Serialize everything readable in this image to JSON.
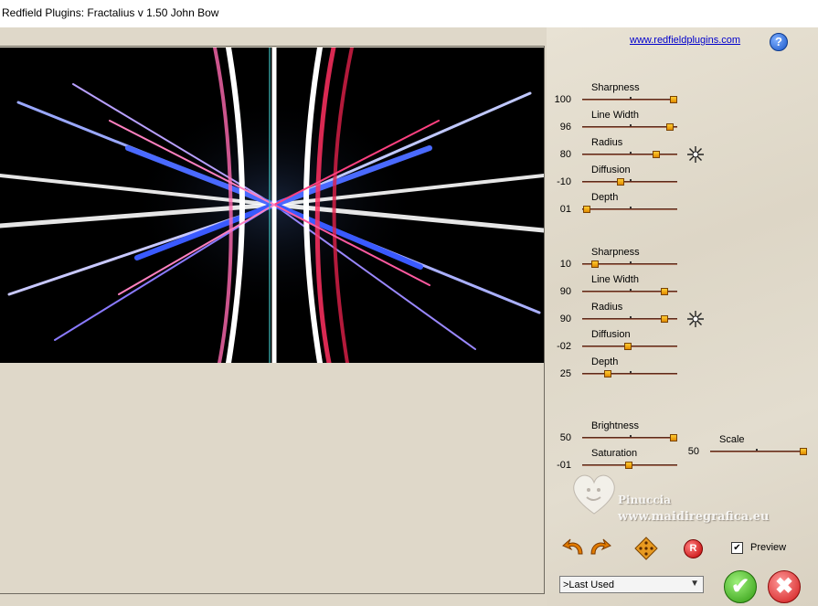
{
  "window": {
    "title": "Redfield Plugins: Fractalius v 1.50  John Bow"
  },
  "header": {
    "link": "www.redfieldplugins.com",
    "help_icon": "question-icon",
    "help_glyph": "?"
  },
  "group1": [
    {
      "label": "Sharpness",
      "value": "100",
      "level": 1.0
    },
    {
      "label": "Line Width",
      "value": "96",
      "level": 0.96
    },
    {
      "label": "Radius",
      "value": "80",
      "level": 0.8
    },
    {
      "label": "Diffusion",
      "value": "-10",
      "level": 0.4
    },
    {
      "label": "Depth",
      "value": "01",
      "level": 0.01
    }
  ],
  "group2": [
    {
      "label": "Sharpness",
      "value": "10",
      "level": 0.1
    },
    {
      "label": "Line Width",
      "value": "90",
      "level": 0.9
    },
    {
      "label": "Radius",
      "value": "90",
      "level": 0.9
    },
    {
      "label": "Diffusion",
      "value": "-02",
      "level": 0.48
    },
    {
      "label": "Depth",
      "value": "25",
      "level": 0.25
    }
  ],
  "group3": [
    {
      "label": "Brightness",
      "value": "50",
      "level": 1.0
    },
    {
      "label": "Saturation",
      "value": "-01",
      "level": 0.49
    }
  ],
  "scale": {
    "label": "Scale",
    "value": "50",
    "level": 1.0
  },
  "watermark": {
    "line1": "Pinuccia",
    "line2": "www.maidiregrafica.eu"
  },
  "preview": {
    "label": "Preview",
    "checked": "✔"
  },
  "presets": {
    "selected": ">Last Used",
    "arrow": "▼"
  },
  "buttons": {
    "ok_glyph": "✔",
    "cancel_glyph": "✖",
    "reset_glyph": "R"
  }
}
